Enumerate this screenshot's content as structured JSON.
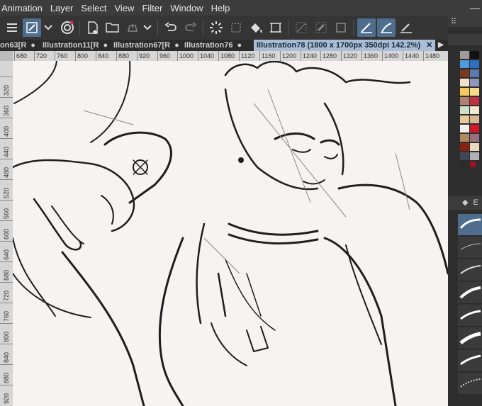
{
  "menubar": {
    "items": [
      "Animation",
      "Layer",
      "Select",
      "View",
      "Filter",
      "Window",
      "Help"
    ],
    "minimize": "—"
  },
  "tabs": [
    {
      "label": "on63[R",
      "closable": false
    },
    {
      "label": "Illustration11[R",
      "closable": false
    },
    {
      "label": "Illustration67[R",
      "closable": false
    },
    {
      "label": "Illustration76",
      "closable": false
    },
    {
      "label": "Illustration78 (1800 x 1700px 350dpi 142.2%)",
      "closable": true,
      "active": true
    }
  ],
  "tab_scroll": "▶",
  "ruler_top": [
    "680",
    "720",
    "760",
    "800",
    "840",
    "880",
    "920",
    "960",
    "1000",
    "1040",
    "1080",
    "1120",
    "1160",
    "1200",
    "1240",
    "1280",
    "1320",
    "1360",
    "1400",
    "1440",
    "1480"
  ],
  "ruler_left": [
    "320",
    "360",
    "400",
    "440",
    "480",
    "520",
    "560",
    "600",
    "640",
    "680",
    "720",
    "760",
    "800",
    "840",
    "880",
    "920"
  ],
  "right_panel": {
    "palette_label": "⠿",
    "brush_header": "E"
  },
  "colors": {
    "active_tab": "#a9bed6",
    "accent": "#4f6d8c",
    "canvas": "#f7f3f1"
  }
}
